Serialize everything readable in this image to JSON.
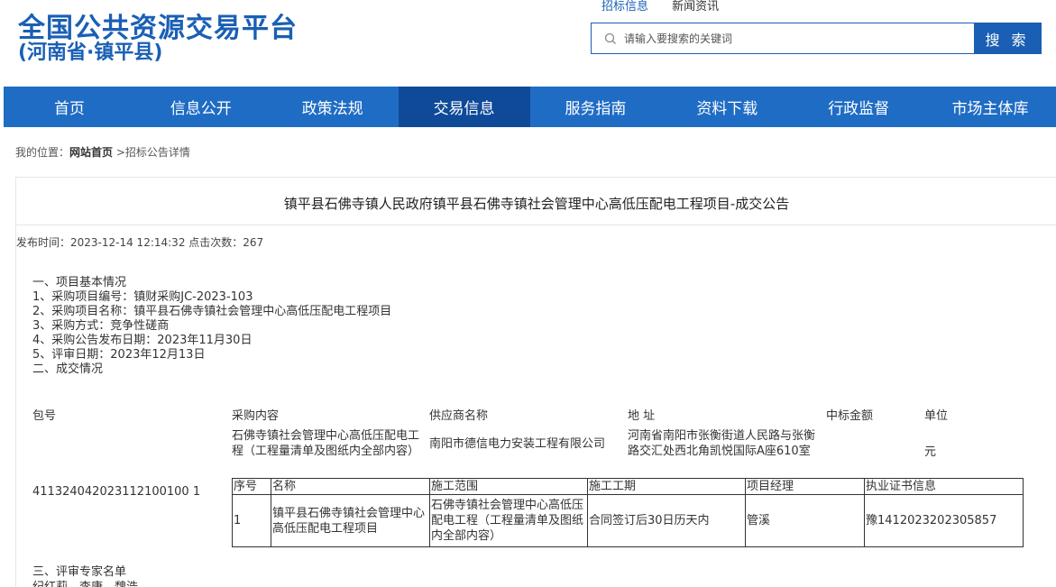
{
  "header": {
    "title": "全国公共资源交易平台",
    "subtitle": "(河南省·镇平县)",
    "search_tabs": [
      "招标信息",
      "新闻资讯"
    ],
    "search_placeholder": "请输入要搜索的关键词",
    "search_button": "搜 索"
  },
  "nav": {
    "items": [
      "首页",
      "信息公开",
      "政策法规",
      "交易信息",
      "服务指南",
      "资料下载",
      "行政监督",
      "市场主体库"
    ],
    "active_index": 3
  },
  "breadcrumb": {
    "prefix": "我的位置：",
    "home": "网站首页",
    "current": " >招标公告详情"
  },
  "article": {
    "title": "镇平县石佛寺镇人民政府镇平县石佛寺镇社会管理中心高低压配电工程项目-成交公告",
    "meta": "发布时间：2023-12-14 12:14:32 点击次数：267",
    "lines": [
      "一、项目基本情况",
      "1、采购项目编号：镇财采购JC-2023-103",
      "2、采购项目名称：镇平县石佛寺镇社会管理中心高低压配电工程项目",
      "3、采购方式：竞争性磋商",
      "4、采购公告发布日期：2023年11月30日",
      "5、评审日期：2023年12月13日",
      "二、成交情况"
    ],
    "award": {
      "headers": [
        "包号",
        "采购内容",
        "供应商名称",
        "地 址",
        "中标金额",
        "单位"
      ],
      "package_no": "411324042023112100100 1",
      "content": "石佛寺镇社会管理中心高低压配电工程（工程量清单及图纸内全部内容）",
      "supplier": "南阳市德信电力安装工程有限公司",
      "address": "河南省南阳市张衡街道人民路与张衡路交汇处西北角凯悦国际A座610室",
      "amount": "",
      "unit": "元"
    },
    "inner_table": {
      "headers": [
        "序号",
        "名称",
        "施工范围",
        "施工工期",
        "项目经理",
        "执业证书信息"
      ],
      "row": [
        "1",
        "镇平县石佛寺镇社会管理中心高低压配电工程项目",
        "石佛寺镇社会管理中心高低压配电工程（工程量清单及图纸内全部内容）",
        "合同签订后30日历天内",
        "管溪",
        "豫1412023202305857"
      ]
    },
    "section3": "三、评审专家名单",
    "experts": "纪红莉、李康、魏浩"
  },
  "colors": {
    "brand": "#1a5fb4",
    "nav_bg": "#1f6cc4",
    "nav_active": "#0f4a99"
  }
}
